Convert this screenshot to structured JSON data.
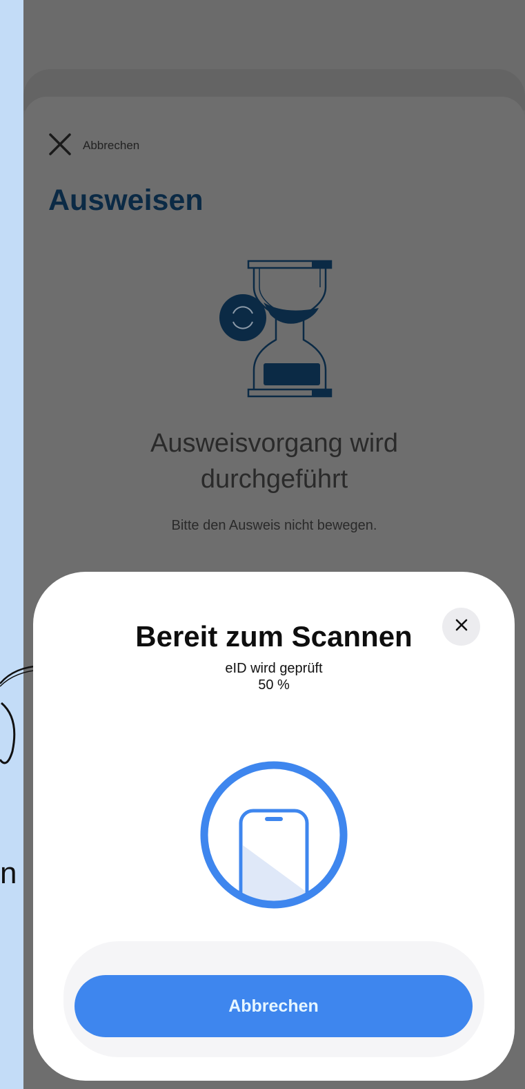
{
  "background": {
    "page_color": "#c3dcf7",
    "annotation_text": "n"
  },
  "page": {
    "cancel_icon": "close-x-icon",
    "cancel_label": "Abbrechen",
    "title": "Ausweisen",
    "illustration": "hourglass-refresh-icon",
    "status_title": "Ausweisvorgang wird\ndurchgeführt",
    "status_subtitle": "Bitte den Ausweis nicht bewegen.",
    "accent": "#0b2a45"
  },
  "nfc_sheet": {
    "title": "Bereit zum Scannen",
    "status_line": "eID wird geprüft",
    "progress_text": "50 %",
    "progress": 0.5,
    "close_icon": "close-icon",
    "illustration": "phone-scan-icon",
    "button_label": "Abbrechen",
    "accent": "#3e86ee"
  }
}
